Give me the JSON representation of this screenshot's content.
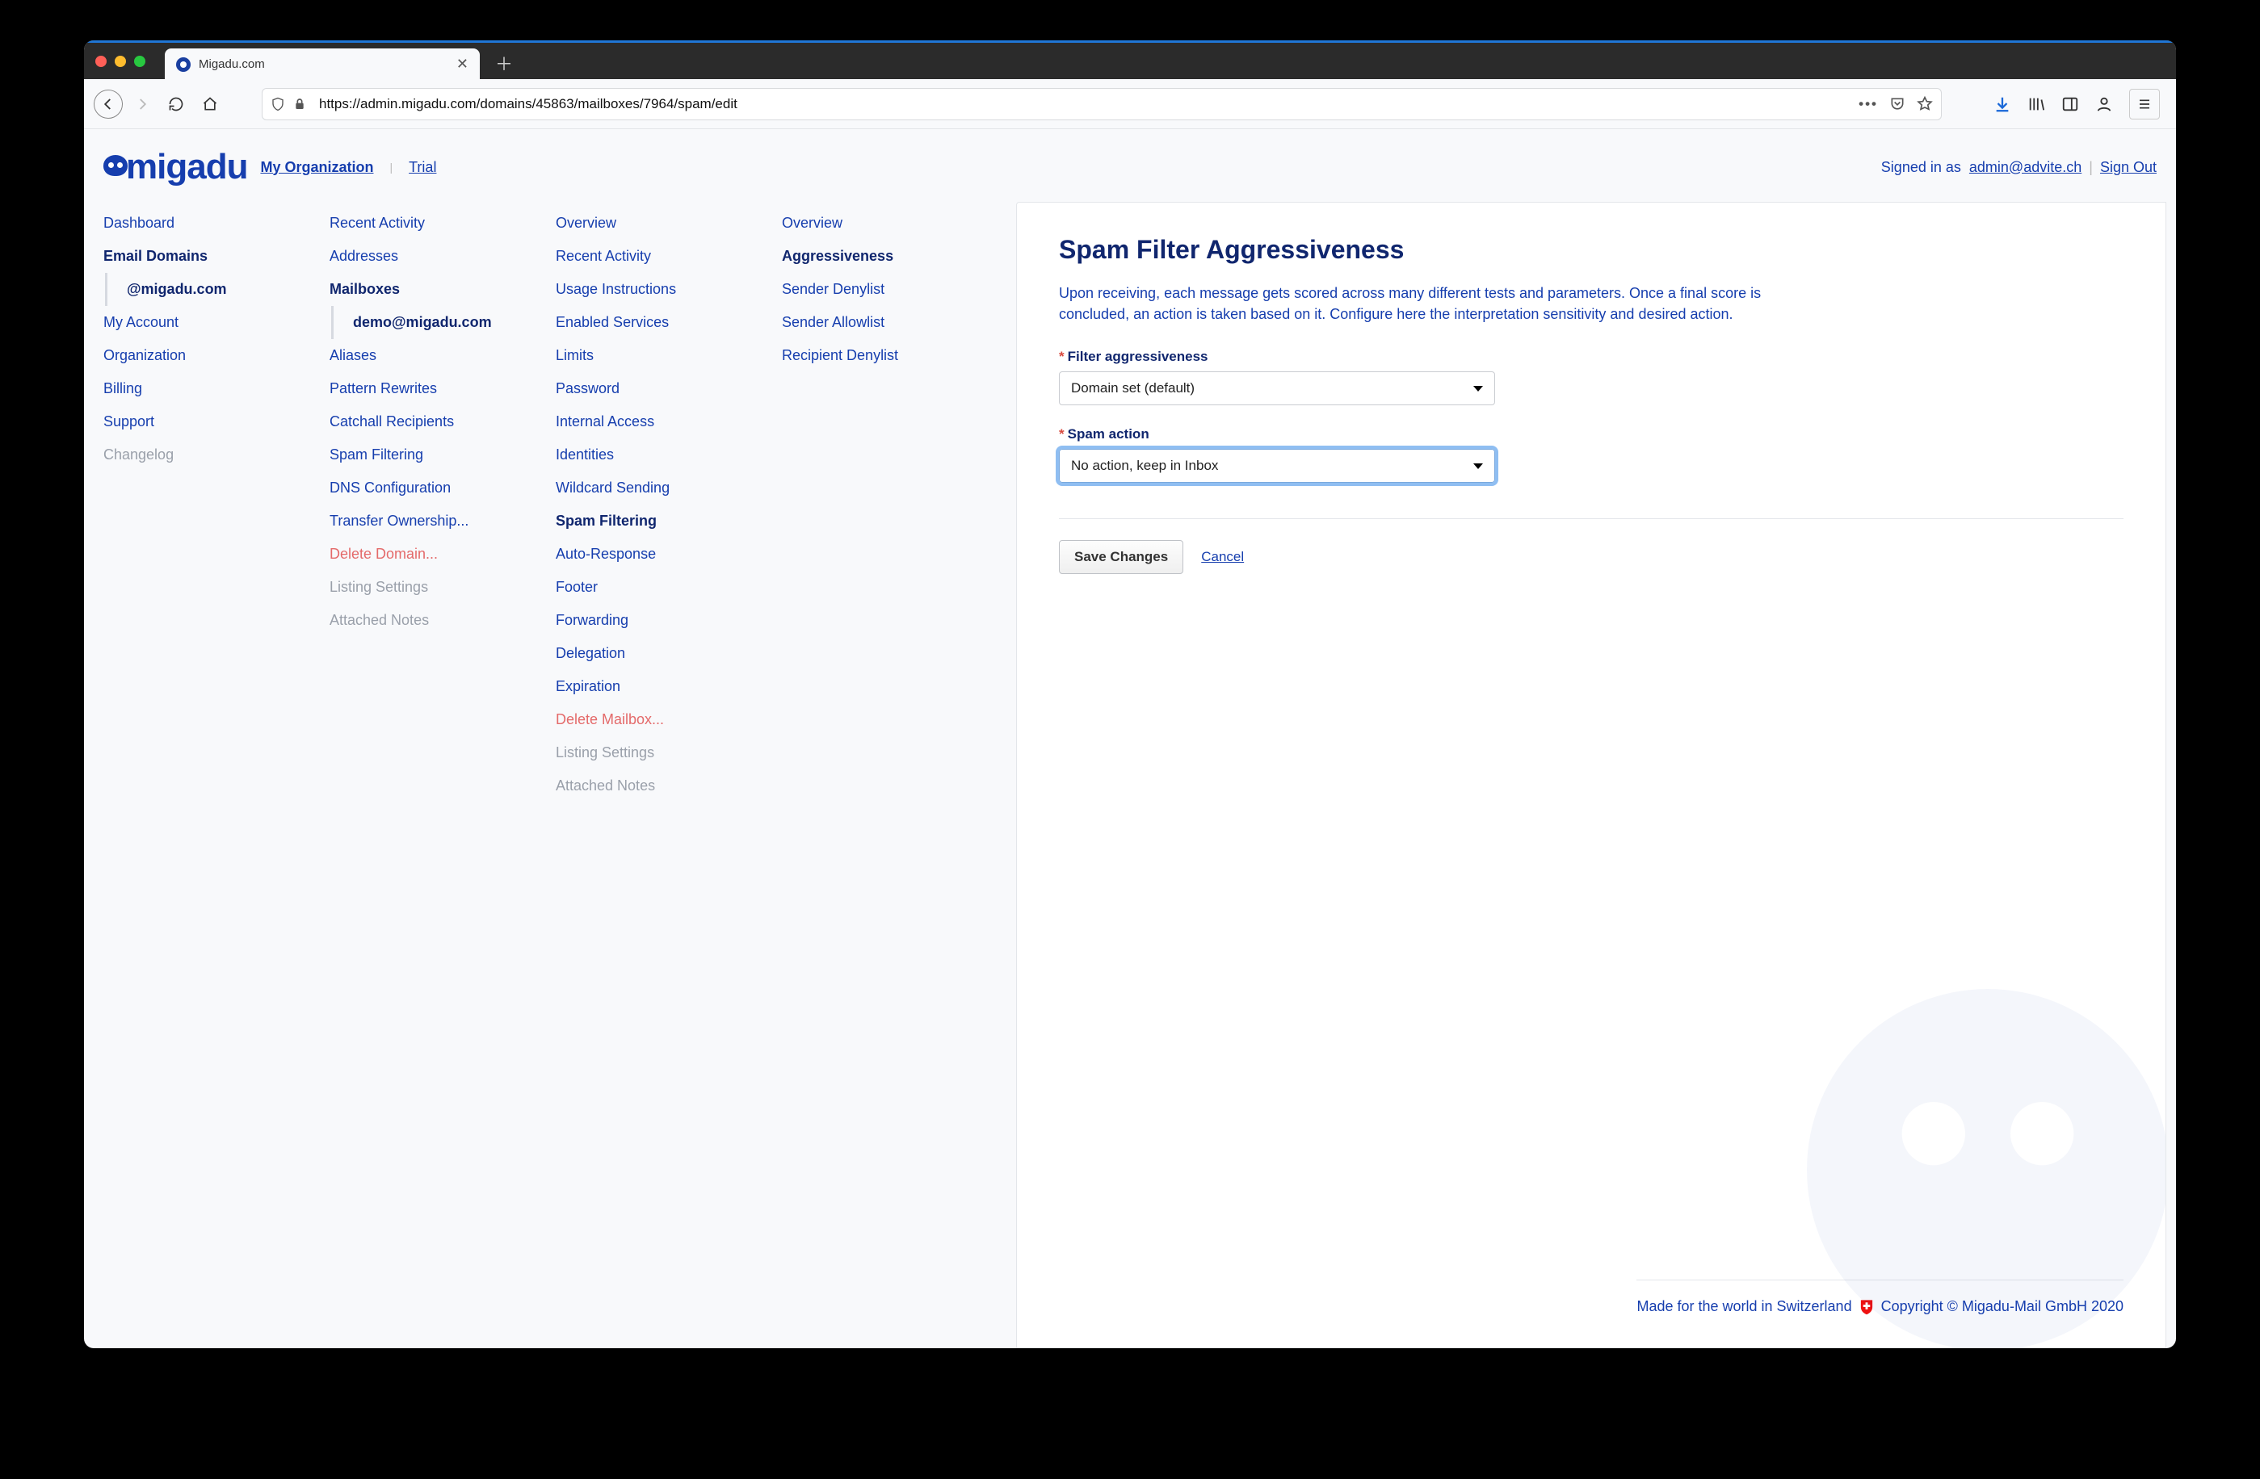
{
  "browser": {
    "tab_title": "Migadu.com",
    "url": "https://admin.migadu.com/domains/45863/mailboxes/7964/spam/edit"
  },
  "header": {
    "logo_text": "migadu",
    "org_link": "My Organization",
    "trial_link": "Trial",
    "signed_in_prefix": "Signed in as",
    "user_email": "admin@advite.ch",
    "sign_out": "Sign Out"
  },
  "nav": {
    "col1": [
      {
        "label": "Dashboard"
      },
      {
        "label": "Email Domains",
        "active": true
      },
      {
        "label": "@migadu.com",
        "active": true,
        "sub": true
      },
      {
        "label": "My Account"
      },
      {
        "label": "Organization"
      },
      {
        "label": "Billing"
      },
      {
        "label": "Support"
      },
      {
        "label": "Changelog",
        "muted": true
      }
    ],
    "col2": [
      {
        "label": "Recent Activity"
      },
      {
        "label": "Addresses"
      },
      {
        "label": "Mailboxes",
        "active": true
      },
      {
        "label": "demo@migadu.com",
        "active": true,
        "sub": true
      },
      {
        "label": "Aliases"
      },
      {
        "label": "Pattern Rewrites"
      },
      {
        "label": "Catchall Recipients"
      },
      {
        "label": "Spam Filtering"
      },
      {
        "label": "DNS Configuration"
      },
      {
        "label": "Transfer Ownership..."
      },
      {
        "label": "Delete Domain...",
        "danger": true
      },
      {
        "label": "Listing Settings",
        "muted": true
      },
      {
        "label": "Attached Notes",
        "muted": true
      }
    ],
    "col3": [
      {
        "label": "Overview"
      },
      {
        "label": "Recent Activity"
      },
      {
        "label": "Usage Instructions"
      },
      {
        "label": "Enabled Services"
      },
      {
        "label": "Limits"
      },
      {
        "label": "Password"
      },
      {
        "label": "Internal Access"
      },
      {
        "label": "Identities"
      },
      {
        "label": "Wildcard Sending"
      },
      {
        "label": "Spam Filtering",
        "active": true
      },
      {
        "label": "Auto-Response"
      },
      {
        "label": "Footer"
      },
      {
        "label": "Forwarding"
      },
      {
        "label": "Delegation"
      },
      {
        "label": "Expiration"
      },
      {
        "label": "Delete Mailbox...",
        "danger": true
      },
      {
        "label": "Listing Settings",
        "muted": true
      },
      {
        "label": "Attached Notes",
        "muted": true
      }
    ],
    "col4": [
      {
        "label": "Overview"
      },
      {
        "label": "Aggressiveness",
        "active": true
      },
      {
        "label": "Sender Denylist"
      },
      {
        "label": "Sender Allowlist"
      },
      {
        "label": "Recipient Denylist"
      }
    ]
  },
  "main": {
    "title": "Spam Filter Aggressiveness",
    "description": "Upon receiving, each message gets scored across many different tests and parameters. Once a final score is concluded, an action is taken based on it. Configure here the interpretation sensitivity and desired action.",
    "field1_label": "Filter aggressiveness",
    "field1_value": "Domain set (default)",
    "field2_label": "Spam action",
    "field2_value": "No action, keep in Inbox",
    "required_marker": "*",
    "save_label": "Save Changes",
    "cancel_label": "Cancel"
  },
  "footer": {
    "left": "Made for the world in Switzerland",
    "right": "Copyright © Migadu-Mail GmbH 2020"
  }
}
